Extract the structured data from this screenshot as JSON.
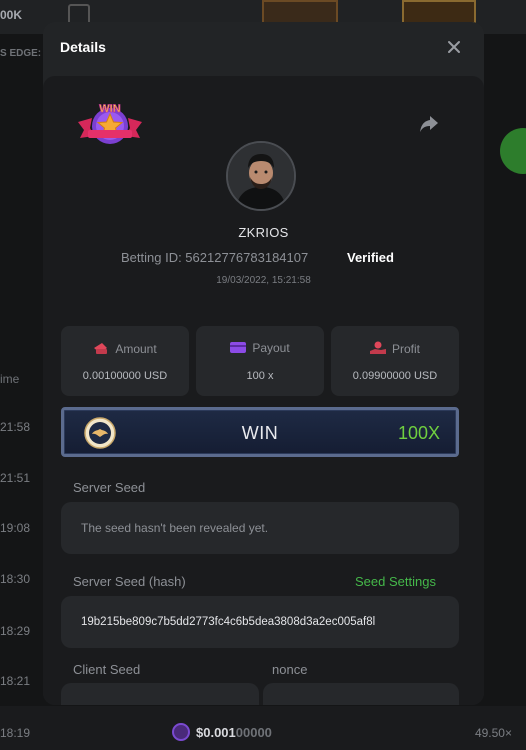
{
  "background": {
    "top_title": "00K",
    "edge_label": "S EDGE:",
    "time_header": "ime",
    "times": [
      "21:58",
      "21:51",
      "19:08",
      "18:30",
      "18:29",
      "18:21",
      "18:19"
    ],
    "bottom": {
      "amount_main": "$0.001",
      "amount_rest": "00000",
      "multiplier": "49.50×"
    }
  },
  "modal": {
    "title": "Details",
    "close_icon": "close-icon",
    "share_icon": "share-icon",
    "badge_text": "WIN",
    "user": {
      "name": "ZKRIOS",
      "betting_id_label": "Betting ID: 56212776783184107",
      "verified_label": "Verified",
      "datetime": "19/03/2022, 15:21:58"
    },
    "stats": [
      {
        "label": "Amount",
        "value": "0.00100000 USD",
        "icon": "amount-icon",
        "color": "#e0475a"
      },
      {
        "label": "Payout",
        "value": "100 x",
        "icon": "payout-icon",
        "color": "#8c4be6"
      },
      {
        "label": "Profit",
        "value": "0.09900000 USD",
        "icon": "profit-icon",
        "color": "#e0475a"
      }
    ],
    "result": {
      "label": "WIN",
      "multiplier": "100X",
      "accent": "#6fcf3f"
    },
    "server_seed": {
      "label": "Server Seed",
      "value": "The seed hasn't been revealed yet."
    },
    "server_seed_hash": {
      "label": "Server Seed (hash)",
      "link": "Seed Settings",
      "value": "19b215be809c7b5dd2773fc4c6b5dea3808d3a2ec005af8l"
    },
    "client_seed": {
      "label": "Client Seed"
    },
    "nonce": {
      "label": "nonce"
    }
  }
}
